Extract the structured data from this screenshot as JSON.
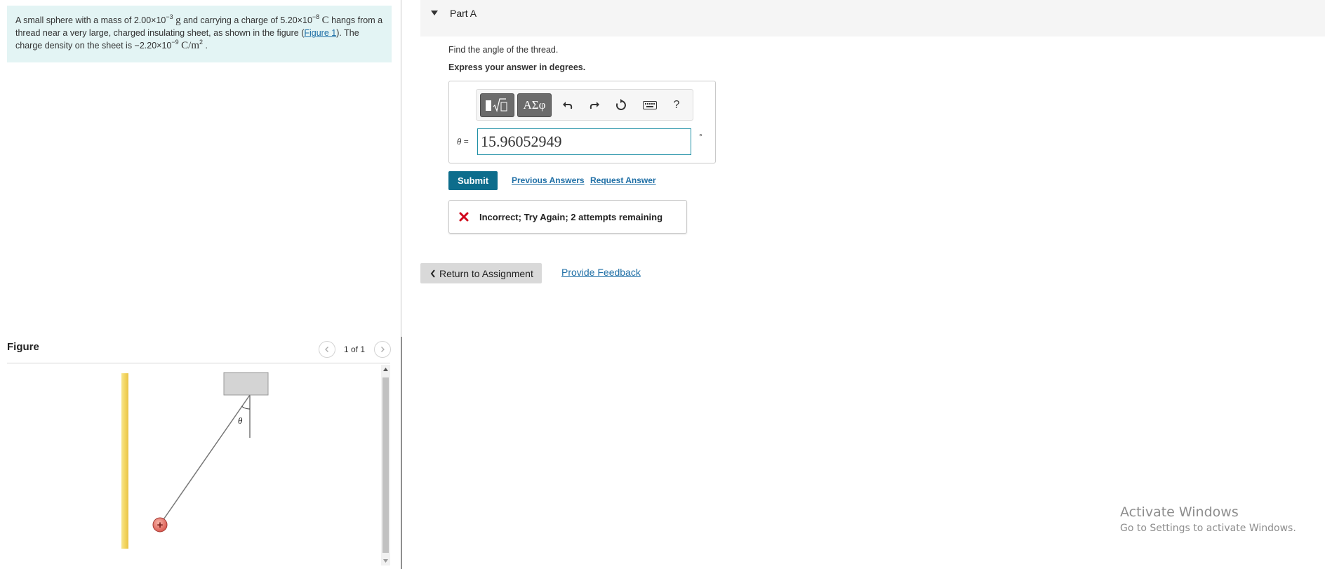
{
  "problem": {
    "text_1": "A small sphere with a mass of 2.00×10",
    "mass_exp": "−3",
    "mass_unit": "g",
    "text_2": " and carrying a charge of 5.20×10",
    "charge_exp": "−8",
    "charge_unit": "C",
    "text_3": " hangs from a thread near a very large, charged insulating sheet, as shown in the figure (",
    "figure_link": "Figure 1",
    "text_4": "). The charge density on the sheet is −2.20×10",
    "density_exp": "−9",
    "density_unit": "C/m",
    "density_unit_exp": "2",
    "text_5": " ."
  },
  "figure": {
    "title": "Figure",
    "pager": "1 of 1",
    "angle_label": "θ",
    "charge_symbol": "+"
  },
  "part": {
    "title": "Part A",
    "question": "Find the angle of the thread.",
    "instruction": "Express your answer in degrees."
  },
  "toolbar": {
    "symbols_label": "ΑΣφ",
    "help_label": "?"
  },
  "answer": {
    "variable": "θ",
    "equals": " =",
    "value": "15.96052949",
    "unit": "°"
  },
  "actions": {
    "submit_label": "Submit",
    "previous_answers_label": "Previous Answers",
    "request_answer_label": "Request Answer"
  },
  "feedback": {
    "message": "Incorrect; Try Again; 2 attempts remaining"
  },
  "navigation": {
    "return_label": "Return to Assignment",
    "provide_feedback_label": "Provide Feedback"
  },
  "watermark": {
    "title": "Activate Windows",
    "subtitle": "Go to Settings to activate Windows."
  },
  "colors": {
    "problem_bg": "#e3f4f4",
    "accent": "#0d6d8c",
    "link": "#1f6fa6",
    "error": "#d0021b",
    "sheet": "#f2d25a"
  },
  "icons": [
    "chevron-left-icon",
    "chevron-right-icon",
    "caret-down-icon",
    "templates-icon",
    "undo-icon",
    "redo-icon",
    "reset-icon",
    "keyboard-icon",
    "x-mark-icon",
    "chevron-left-small-icon"
  ]
}
